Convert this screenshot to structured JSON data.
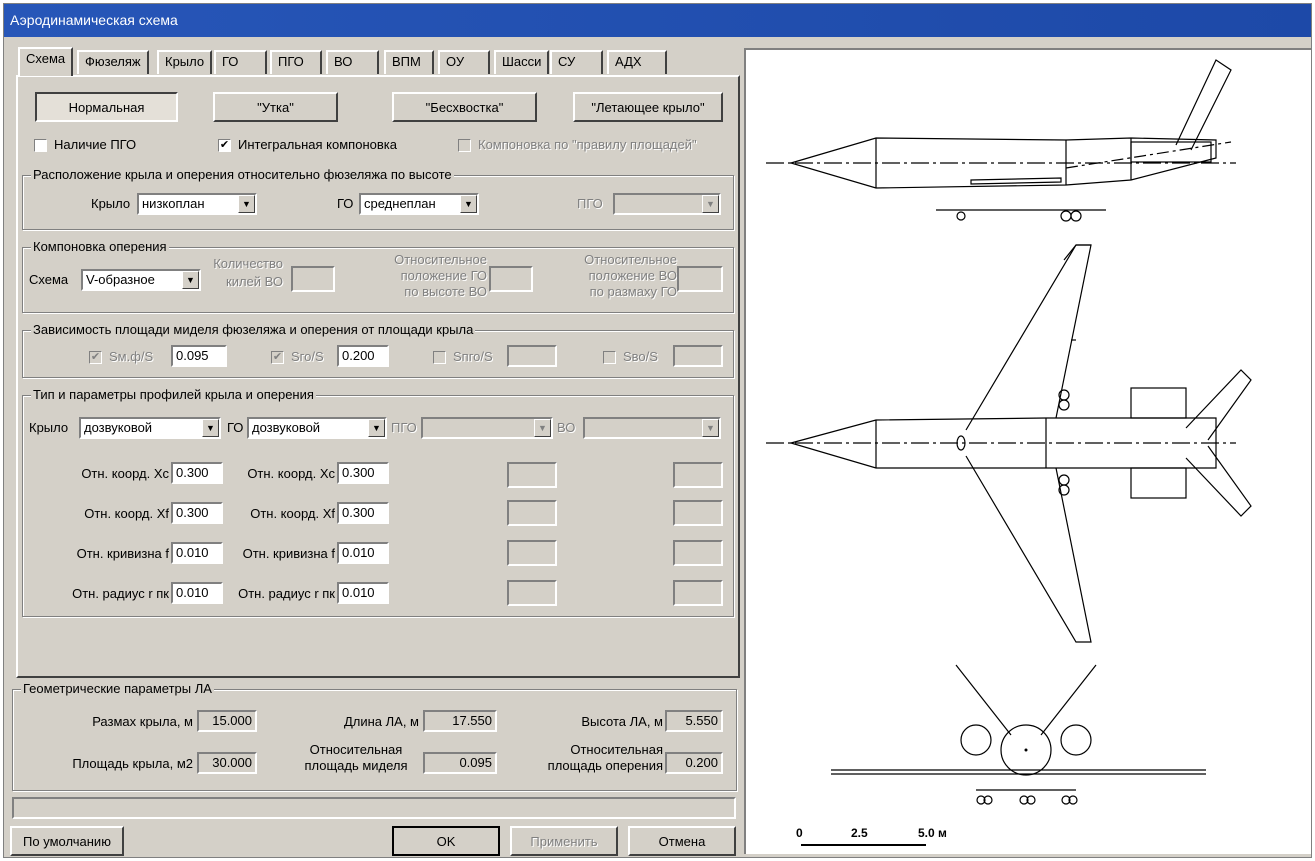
{
  "window": {
    "title": "Аэродинамическая схема"
  },
  "tabs": [
    "Схема",
    "Фюзеляж",
    "Крыло",
    "ГО",
    "ПГО",
    "ВО",
    "ВПМ",
    "ОУ",
    "Шасси",
    "СУ",
    "АДХ"
  ],
  "schemes": [
    "Нормальная",
    "\"Утка\"",
    "\"Бесхвостка\"",
    "\"Летающее крыло\""
  ],
  "options": {
    "pgo": {
      "label": "Наличие ПГО",
      "checked": false
    },
    "integral": {
      "label": "Интегральная компоновка",
      "checked": true
    },
    "area_rule": {
      "label": "Компоновка по \"правилу площадей\"",
      "checked": false
    }
  },
  "placement": {
    "title": "Расположение крыла и оперения относительно фюзеляжа по высоте",
    "wing_label": "Крыло",
    "wing_value": "низкоплан",
    "go_label": "ГО",
    "go_value": "среднеплан",
    "pgo_label": "ПГО",
    "pgo_value": ""
  },
  "tail": {
    "title": "Компоновка оперения",
    "scheme_label": "Схема",
    "scheme_value": "V-образное",
    "fins_label_1": "Количество",
    "fins_label_2": "килей ВО",
    "fins_value": "",
    "rel_go_1": "Относительное",
    "rel_go_2": "положение ГО",
    "rel_go_3": "по высоте ВО",
    "rel_go_value": "",
    "rel_vo_1": "Относительное",
    "rel_vo_2": "положение ВО",
    "rel_vo_3": "по размаху ГО",
    "rel_vo_value": ""
  },
  "area": {
    "title": "Зависимость площади миделя фюзеляжа и оперения от площади крыла",
    "items": [
      {
        "label": "Sм.ф/S",
        "value": "0.095",
        "checked": true
      },
      {
        "label": "Sго/S",
        "value": "0.200",
        "checked": true
      },
      {
        "label": "Sпго/S",
        "value": "",
        "checked": false
      },
      {
        "label": "Sво/S",
        "value": "",
        "checked": false
      }
    ]
  },
  "profiles": {
    "title": "Тип и параметры профилей крыла и оперения",
    "wing_label": "Крыло",
    "wing_value": "дозвуковой",
    "go_label": "ГО",
    "go_value": "дозвуковой",
    "pgo_label": "ПГО",
    "vo_label": "ВО",
    "rows": [
      {
        "label1": "Отн. коорд. Xc",
        "value1": "0.300",
        "label2": "Отн. коорд. Xc",
        "value2": "0.300"
      },
      {
        "label1": "Отн. коорд. Xf",
        "value1": "0.300",
        "label2": "Отн. коорд. Xf",
        "value2": "0.300"
      },
      {
        "label1": "Отн. кривизна f",
        "value1": "0.010",
        "label2": "Отн. кривизна f",
        "value2": "0.010"
      },
      {
        "label1": "Отн. радиус r пк",
        "value1": "0.010",
        "label2": "Отн. радиус r пк",
        "value2": "0.010"
      }
    ]
  },
  "geometry": {
    "title": "Геометрические параметры ЛА",
    "span_label": "Размах крыла, м",
    "span_value": "15.000",
    "length_label": "Длина ЛА, м",
    "length_value": "17.550",
    "height_label": "Высота ЛА, м",
    "height_value": "5.550",
    "area_label": "Площадь крыла, м2",
    "area_value": "30.000",
    "mid_1": "Относительная",
    "mid_2": "площадь миделя",
    "mid_value": "0.095",
    "tailarea_1": "Относительная",
    "tailarea_2": "площадь оперения",
    "tailarea_value": "0.200"
  },
  "footer": {
    "defaults": "По умолчанию",
    "ok": "OK",
    "apply": "Применить",
    "cancel": "Отмена"
  },
  "scale": {
    "t0": "0",
    "t1": "2.5",
    "t2": "5.0 м"
  }
}
